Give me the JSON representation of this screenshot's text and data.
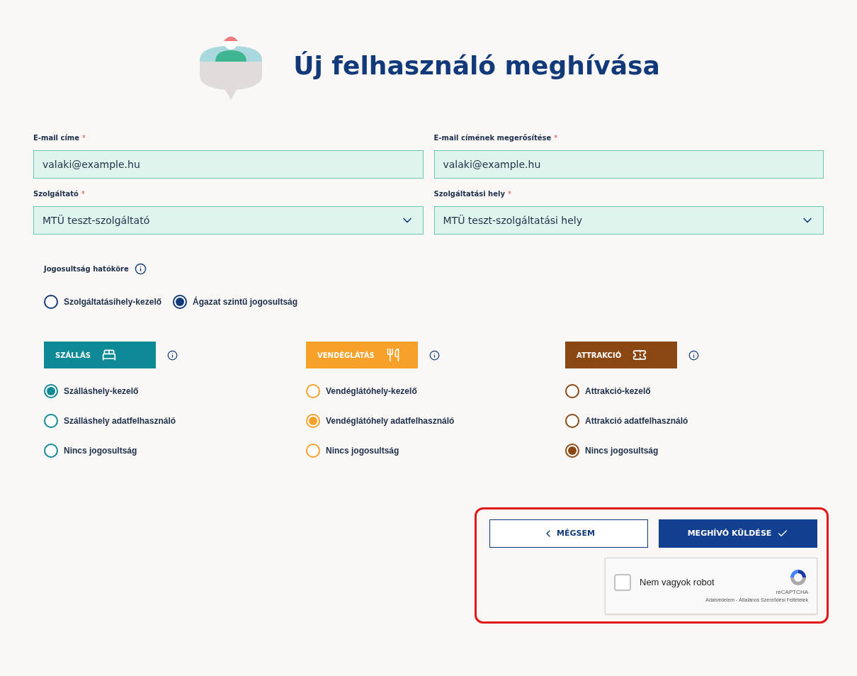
{
  "title": "Új felhasználó meghívása",
  "fields": [
    {
      "kind": "text",
      "label": "E-mail címe",
      "required_mark": "*",
      "value": "valaki@example.hu"
    },
    {
      "kind": "text",
      "label": "E-mail címének megerősítése",
      "required_mark": "*",
      "value": "valaki@example.hu"
    },
    {
      "kind": "select",
      "label": "Szolgáltató",
      "required_mark": "*",
      "value": "MTÜ teszt-szolgáltató"
    },
    {
      "kind": "select",
      "label": "Szolgáltatási hely",
      "required_mark": "*",
      "value": "MTÜ teszt-szolgáltatási hely"
    }
  ],
  "scope": {
    "label": "Jogosultság hatóköre",
    "options": [
      {
        "label": "Szolgáltatásihely-kezelő",
        "selected": false
      },
      {
        "label": "Ágazat szintű jogosultság",
        "selected": true
      }
    ]
  },
  "categories": [
    {
      "kind": "bed",
      "name": "SZÁLLÁS",
      "color": "#0e8a96",
      "options": [
        {
          "label": "Szálláshely-kezelő",
          "selected": true
        },
        {
          "label": "Szálláshely adatfelhasználó",
          "selected": false
        },
        {
          "label": "Nincs jogosultság",
          "selected": false
        }
      ]
    },
    {
      "kind": "food",
      "name": "VENDÉGLÁTÁS",
      "color": "#f7a12a",
      "options": [
        {
          "label": "Vendéglátóhely-kezelő",
          "selected": false
        },
        {
          "label": "Vendéglátóhely adatfelhasználó",
          "selected": true
        },
        {
          "label": "Nincs jogosultság",
          "selected": false
        }
      ]
    },
    {
      "kind": "ticket",
      "name": "ATTRAKCIÓ",
      "color": "#8a4711",
      "options": [
        {
          "label": "Attrakció-kezelő",
          "selected": false
        },
        {
          "label": "Attrakció adatfelhasználó",
          "selected": false
        },
        {
          "label": "Nincs jogosultság",
          "selected": true
        }
      ]
    }
  ],
  "actions": {
    "cancel": "MÉGSEM",
    "submit": "MEGHÍVÓ KÜLDÉSE"
  },
  "captcha": {
    "checked": false,
    "label": "Nem vagyok robot",
    "brand": "reCAPTCHA",
    "footer": "Adatvédelem - Általános Szerződési Feltételek"
  }
}
